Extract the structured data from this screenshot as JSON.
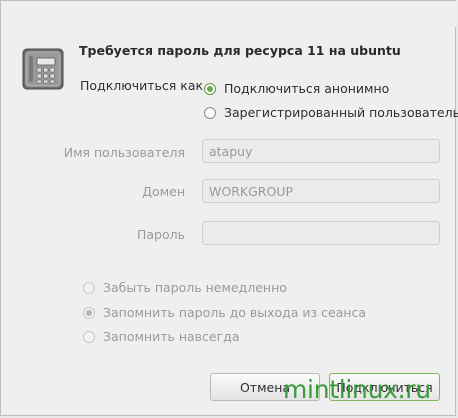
{
  "dialog": {
    "title": "Требуется пароль для ресурса 11 на ubuntu",
    "connect_as_label": "Подключиться как",
    "connect_options": [
      {
        "label": "Подключиться анонимно",
        "checked": true
      },
      {
        "label": "Зарегистрированный пользователь",
        "checked": false
      }
    ],
    "fields": {
      "username_label": "Имя пользователя",
      "username_value": "atapuy",
      "domain_label": "Домен",
      "domain_value": "WORKGROUP",
      "password_label": "Пароль",
      "password_value": ""
    },
    "remember_options": [
      {
        "label": "Забыть пароль немедленно",
        "checked": false
      },
      {
        "label": "Запомнить пароль до выхода из сеанса",
        "checked": true
      },
      {
        "label": "Запомнить навсегда",
        "checked": false
      }
    ],
    "buttons": {
      "cancel": "Отмена",
      "connect": "Подключиться"
    }
  },
  "watermark": "mintlinux.ru",
  "icon": "safe-lock-icon",
  "colors": {
    "accent": "#6aa84f",
    "watermark": "#3b9a3b"
  }
}
